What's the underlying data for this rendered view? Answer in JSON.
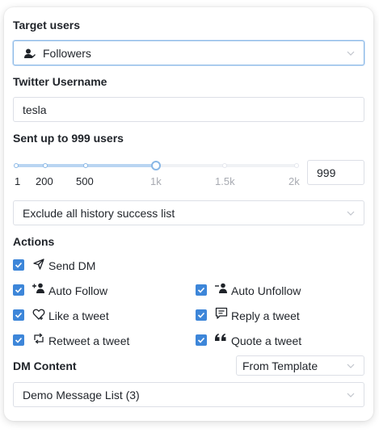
{
  "target_users": {
    "title": "Target users",
    "selected": "Followers",
    "icon": "user-follow-icon"
  },
  "twitter_username": {
    "title": "Twitter Username",
    "value": "tesla"
  },
  "sent_up_to": {
    "title": "Sent up to 999 users",
    "slider_ticks": [
      "1",
      "200",
      "500",
      "1k",
      "1.5k",
      "2k"
    ],
    "slider_value_fraction": 0.5,
    "value": "999"
  },
  "history_select": {
    "selected": "Exclude all history success list"
  },
  "actions": {
    "title": "Actions",
    "items": [
      {
        "label": "Send DM",
        "checked": true,
        "icon": "send-icon"
      },
      {
        "label": "Auto Follow",
        "checked": true,
        "icon": "user-add-icon"
      },
      {
        "label": "Auto Unfollow",
        "checked": true,
        "icon": "user-remove-icon"
      },
      {
        "label": "Like a tweet",
        "checked": true,
        "icon": "heart-icon"
      },
      {
        "label": "Reply a tweet",
        "checked": true,
        "icon": "comment-icon"
      },
      {
        "label": "Retweet a tweet",
        "checked": true,
        "icon": "retweet-icon"
      },
      {
        "label": "Quote a tweet",
        "checked": true,
        "icon": "quote-icon"
      }
    ]
  },
  "dm_content": {
    "title": "DM Content",
    "source_selected": "From Template",
    "template_selected": "Demo Message List (3)"
  },
  "colors": {
    "accent": "#3d86d9",
    "slider_track": "#b9d5f2",
    "border": "#dcdfe6",
    "muted_text": "#a8abb2"
  }
}
